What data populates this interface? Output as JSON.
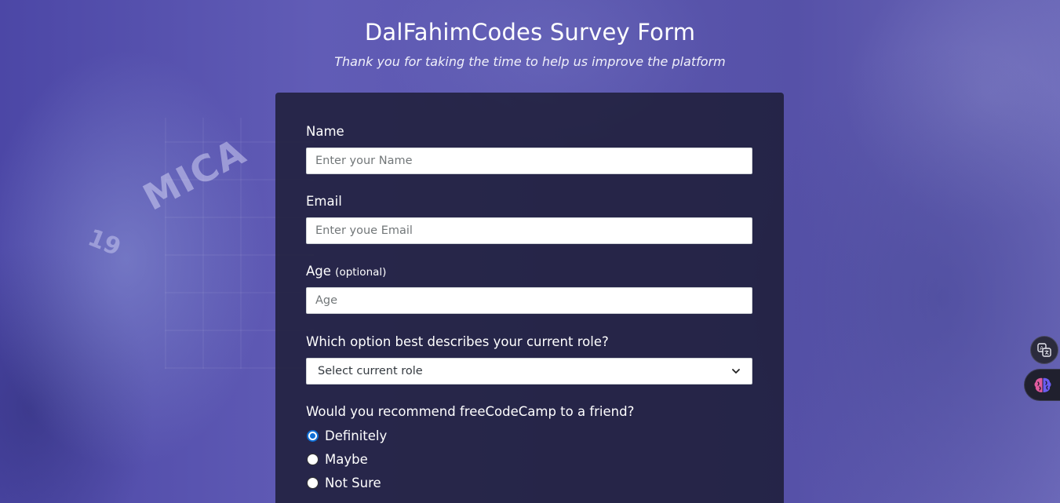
{
  "header": {
    "title": "DalFahimCodes Survey Form",
    "subtitle": "Thank you for taking the time to help us improve the platform"
  },
  "background": {
    "jersey_text": "MICA",
    "jersey_number": "19"
  },
  "form": {
    "name": {
      "label": "Name",
      "placeholder": "Enter your Name"
    },
    "email": {
      "label": "Email",
      "placeholder": "Enter youe Email"
    },
    "age": {
      "label": "Age",
      "label_suffix": "(optional)",
      "placeholder": "Age"
    },
    "role": {
      "label": "Which option best describes your current role?",
      "selected": "Select current role"
    },
    "recommend": {
      "label": "Would you recommend freeCodeCamp to a friend?",
      "options": [
        {
          "label": "Definitely",
          "checked": true
        },
        {
          "label": "Maybe",
          "checked": false
        },
        {
          "label": "Not Sure",
          "checked": false
        }
      ]
    }
  },
  "extensions": {
    "translate_icon": "translate-icon",
    "brain_icon": "brain-icon"
  },
  "colors": {
    "card_bg": "#1b1b32",
    "radio_checked": "#0f6fd6",
    "brain_left": "#e05a9e",
    "brain_right": "#6a5cf0"
  }
}
